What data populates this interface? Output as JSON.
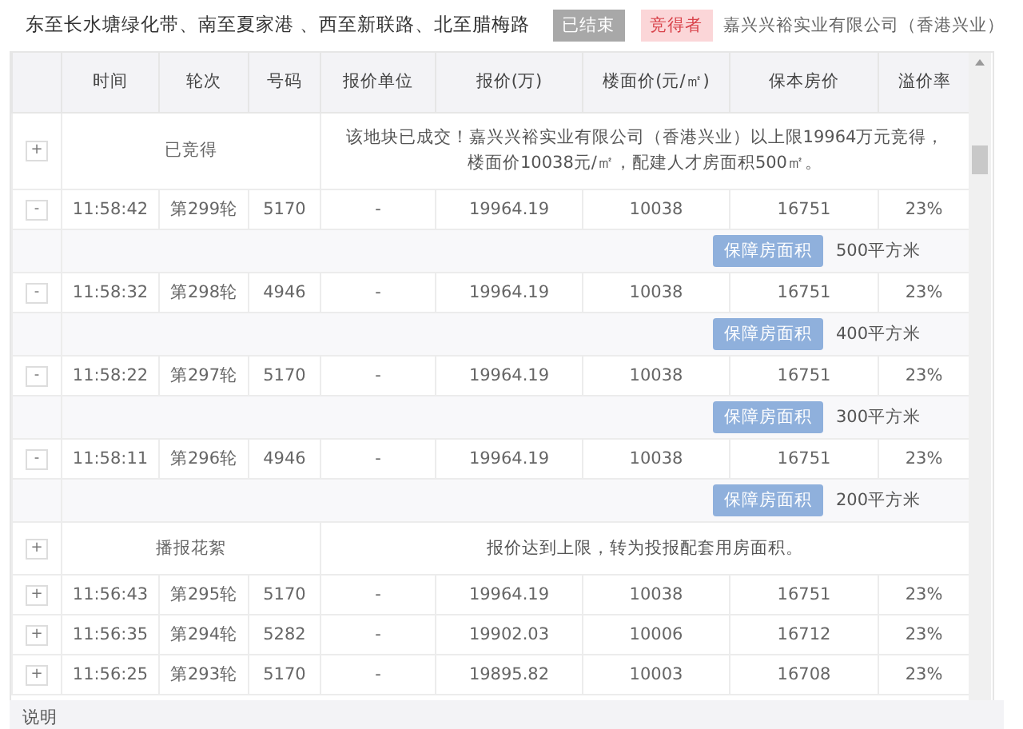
{
  "header": {
    "location": "东至长水塘绿化带、南至夏家港 、西至新联路、北至腊梅路",
    "status": {
      "label": "已结束",
      "disabled": true
    },
    "winner_tag": "竞得者",
    "winner": "嘉兴兴裕实业有限公司（香港兴业）"
  },
  "table": {
    "columns": [
      "时间",
      "轮次",
      "号码",
      "报价单位",
      "报价(万)",
      "楼面价(元/㎡)",
      "保本房价",
      "溢价率"
    ],
    "rows": [
      {
        "kind": "group",
        "toggle": "+",
        "label": "已竞得",
        "message": "该地块已成交！嘉兴兴裕实业有限公司（香港兴业）以上限19964万元竞得，楼面价10038元/㎡，配建人才房面积500㎡。"
      },
      {
        "kind": "bid",
        "toggle": "-",
        "cells": [
          "11:58:42",
          "第299轮",
          "5170",
          "-",
          "19964.19",
          "10038",
          "16751",
          "23%"
        ]
      },
      {
        "kind": "area",
        "button": "保障房面积",
        "area": "500平方米"
      },
      {
        "kind": "bid",
        "toggle": "-",
        "cells": [
          "11:58:32",
          "第298轮",
          "4946",
          "-",
          "19964.19",
          "10038",
          "16751",
          "23%"
        ]
      },
      {
        "kind": "area",
        "button": "保障房面积",
        "area": "400平方米"
      },
      {
        "kind": "bid",
        "toggle": "-",
        "cells": [
          "11:58:22",
          "第297轮",
          "5170",
          "-",
          "19964.19",
          "10038",
          "16751",
          "23%"
        ]
      },
      {
        "kind": "area",
        "button": "保障房面积",
        "area": "300平方米"
      },
      {
        "kind": "bid",
        "toggle": "-",
        "cells": [
          "11:58:11",
          "第296轮",
          "4946",
          "-",
          "19964.19",
          "10038",
          "16751",
          "23%"
        ]
      },
      {
        "kind": "area",
        "button": "保障房面积",
        "area": "200平方米"
      },
      {
        "kind": "group",
        "toggle": "+",
        "label": "播报花絮",
        "message": "报价达到上限，转为投报配套用房面积。"
      },
      {
        "kind": "bid",
        "toggle": "+",
        "cells": [
          "11:56:43",
          "第295轮",
          "5170",
          "-",
          "19964.19",
          "10038",
          "16751",
          "23%"
        ]
      },
      {
        "kind": "bid",
        "toggle": "+",
        "cells": [
          "11:56:35",
          "第294轮",
          "5282",
          "-",
          "19902.03",
          "10006",
          "16712",
          "23%"
        ]
      },
      {
        "kind": "bid",
        "toggle": "+",
        "cells": [
          "11:56:25",
          "第293轮",
          "5170",
          "-",
          "19895.82",
          "10003",
          "16708",
          "23%"
        ]
      }
    ]
  },
  "footer": "说明"
}
